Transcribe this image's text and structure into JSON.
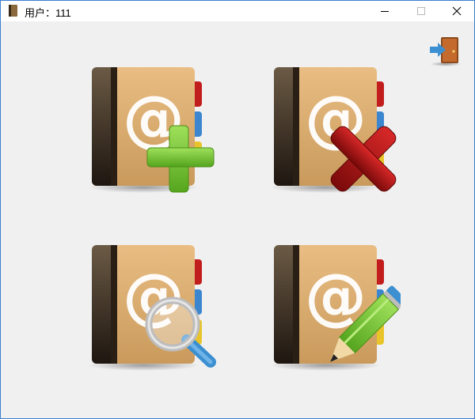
{
  "window": {
    "title": "用户：111",
    "controls": {
      "minimize": "minimize-icon",
      "maximize": "maximize-icon",
      "close": "close-icon"
    }
  },
  "tiles": [
    {
      "name": "add-contact",
      "icon": "address-book-add-icon"
    },
    {
      "name": "delete-contact",
      "icon": "address-book-delete-icon"
    },
    {
      "name": "search-contact",
      "icon": "address-book-search-icon"
    },
    {
      "name": "edit-contact",
      "icon": "address-book-edit-icon"
    }
  ],
  "exit": {
    "icon": "exit-door-icon"
  },
  "colors": {
    "window_border": "#3b7fd3",
    "background": "#f0f0f0",
    "book_cover": "#d9a86c",
    "book_spine": "#3a2a1a",
    "add_green": "#7ac943",
    "delete_red": "#b01414",
    "pencil_green": "#8cd23a",
    "magnifier_blue": "#3c8fd0"
  }
}
